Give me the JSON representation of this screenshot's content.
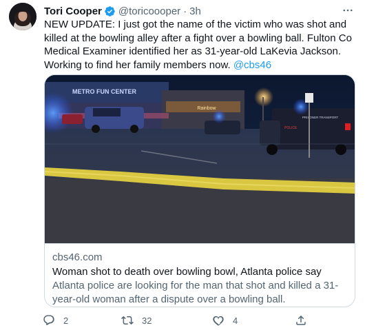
{
  "author": {
    "display_name": "Tori Cooper",
    "handle": "@toricoooper",
    "separator": "·",
    "time": "3h",
    "verified": true
  },
  "tweet": {
    "text_main": "NEW UPDATE: I just got the name of the victim who was shot and killed at the bowling alley after a fight over a bowling ball. Fulton Co Medical Examiner identified her as 31-year-old LaKevia Jackson. Working to find her family members now. ",
    "mention": "@cbs46"
  },
  "card": {
    "domain": "cbs46.com",
    "title": "Woman shot to death over bowling bowl, Atlanta police say",
    "description": "Atlanta police are looking for the man that shot and killed a 31-year-old woman after a dispute over a bowling ball.",
    "image": {
      "sign_text": "METRO FUN CENTER",
      "store_sign": "Rainbow",
      "van_text": "PRISONER TRANSPORT",
      "van_label": "POLICE"
    }
  },
  "actions": {
    "reply_count": "2",
    "retweet_count": "32",
    "like_count": "4"
  },
  "icons": {
    "verified": "verified-badge-icon",
    "more": "more-icon",
    "reply": "reply-icon",
    "retweet": "retweet-icon",
    "like": "heart-icon",
    "share": "share-icon"
  },
  "colors": {
    "link": "#1d9bf0",
    "secondary_text": "#536471",
    "primary_text": "#0f1419",
    "border": "#cfd9de"
  }
}
